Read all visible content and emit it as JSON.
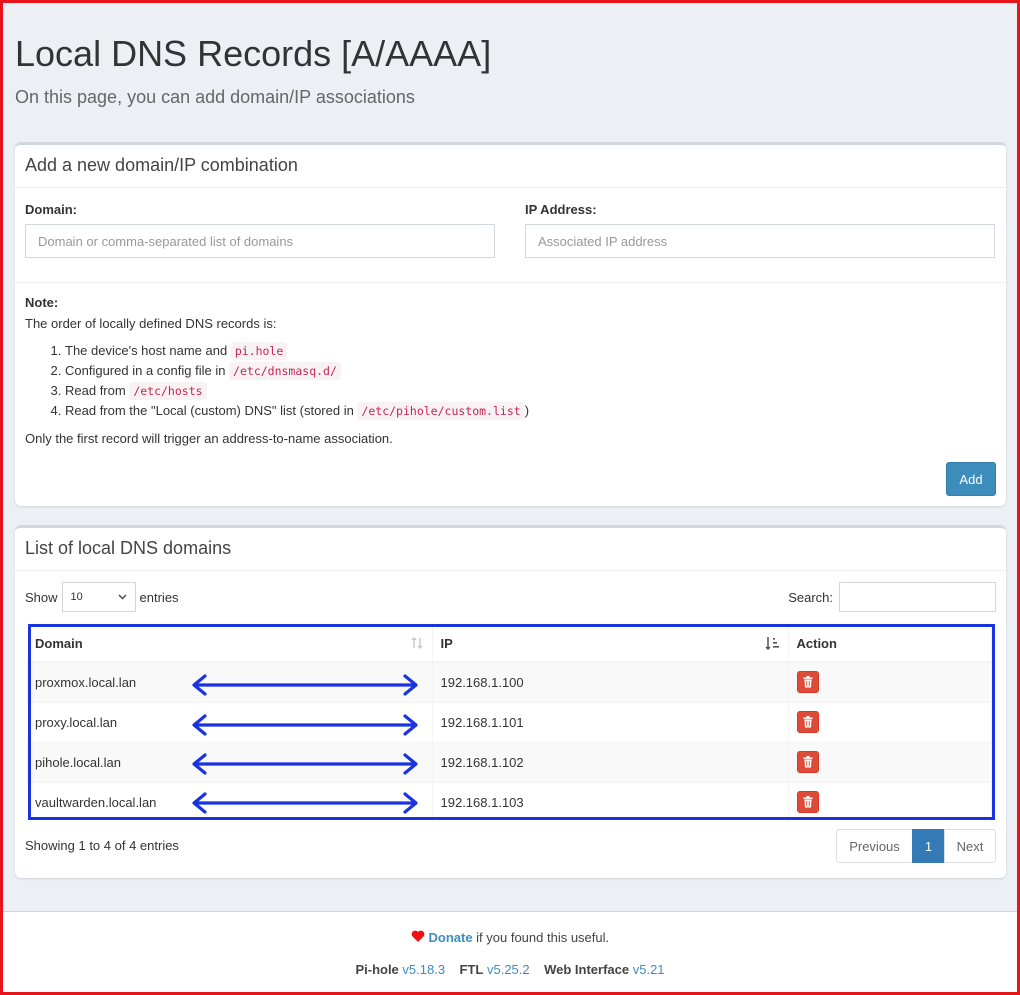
{
  "header": {
    "title": "Local DNS Records [A/AAAA]",
    "subtitle": "On this page, you can add domain/IP associations"
  },
  "add_box": {
    "title": "Add a new domain/IP combination",
    "domain_label": "Domain:",
    "domain_placeholder": "Domain or comma-separated list of domains",
    "domain_value": "",
    "ip_label": "IP Address:",
    "ip_placeholder": "Associated IP address",
    "ip_value": "",
    "note": {
      "title": "Note:",
      "intro": "The order of locally defined DNS records is:",
      "items": [
        {
          "text": "The device's host name and ",
          "code": "pi.hole",
          "suffix": ""
        },
        {
          "text": "Configured in a config file in ",
          "code": "/etc/dnsmasq.d/",
          "suffix": ""
        },
        {
          "text": "Read from ",
          "code": "/etc/hosts",
          "suffix": ""
        },
        {
          "text": "Read from the \"Local (custom) DNS\" list (stored in ",
          "code": "/etc/pihole/custom.list",
          "suffix": ")"
        }
      ],
      "outro": "Only the first record will trigger an address-to-name association."
    },
    "add_button": "Add"
  },
  "list_box": {
    "title": "List of local DNS domains",
    "show_label": "Show",
    "entries_label": "entries",
    "length_value": "10",
    "search_label": "Search:",
    "search_value": "",
    "columns": [
      "Domain",
      "IP",
      "Action"
    ],
    "rows": [
      {
        "domain": "proxmox.local.lan",
        "ip": "192.168.1.100"
      },
      {
        "domain": "proxy.local.lan",
        "ip": "192.168.1.101"
      },
      {
        "domain": "pihole.local.lan",
        "ip": "192.168.1.102"
      },
      {
        "domain": "vaultwarden.local.lan",
        "ip": "192.168.1.103"
      }
    ],
    "info": "Showing 1 to 4 of 4 entries",
    "pagination": {
      "previous": "Previous",
      "current": "1",
      "next": "Next"
    }
  },
  "footer": {
    "donate": "Donate",
    "donate_suffix": " if you found this useful.",
    "pihole_label": "Pi-hole",
    "pihole_version": "v5.18.3",
    "ftl_label": "FTL",
    "ftl_version": "v5.25.2",
    "web_label": "Web Interface",
    "web_version": "v5.21"
  },
  "colors": {
    "primary": "#3c8dbc",
    "danger": "#dd4b39",
    "annotation_box": "#1a33e0",
    "annotation_arrow": "#1a33e0",
    "frame": "#e8141c"
  },
  "icons": {
    "sort_both": "sort-icon",
    "sort_desc": "sort-numeric-desc-icon",
    "delete": "trash-icon",
    "heart": "heart-icon"
  }
}
